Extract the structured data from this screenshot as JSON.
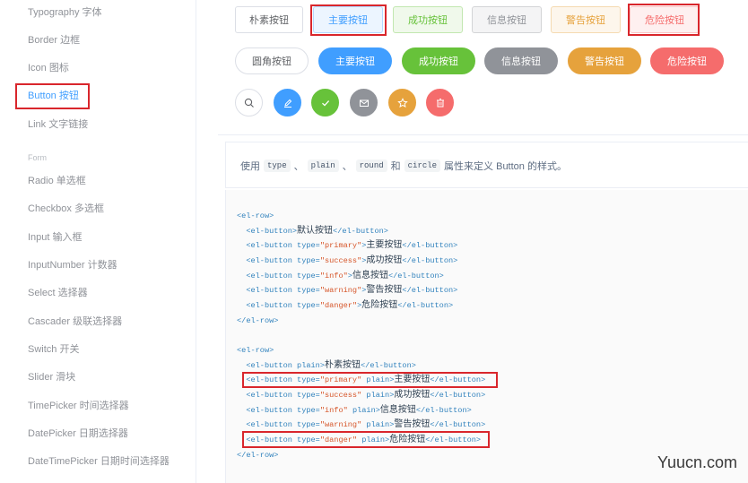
{
  "sidebar": {
    "items": [
      {
        "label": "Typography 字体"
      },
      {
        "label": "Border 边框"
      },
      {
        "label": "Icon 图标"
      },
      {
        "label": "Button 按钮"
      },
      {
        "label": "Link 文字链接"
      },
      {
        "label": "Form"
      },
      {
        "label": "Radio 单选框"
      },
      {
        "label": "Checkbox 多选框"
      },
      {
        "label": "Input 输入框"
      },
      {
        "label": "InputNumber 计数器"
      },
      {
        "label": "Select 选择器"
      },
      {
        "label": "Cascader 级联选择器"
      },
      {
        "label": "Switch 开关"
      },
      {
        "label": "Slider 滑块"
      },
      {
        "label": "TimePicker 时间选择器"
      },
      {
        "label": "DatePicker 日期选择器"
      },
      {
        "label": "DateTimePicker 日期时间选择器"
      }
    ]
  },
  "demo": {
    "plain_row": [
      "朴素按钮",
      "主要按钮",
      "成功按钮",
      "信息按钮",
      "警告按钮",
      "危险按钮"
    ],
    "round_row": [
      "圆角按钮",
      "主要按钮",
      "成功按钮",
      "信息按钮",
      "警告按钮",
      "危险按钮"
    ],
    "circle_icons": [
      "search-icon",
      "edit-icon",
      "check-icon",
      "message-icon",
      "star-icon",
      "delete-icon"
    ]
  },
  "description": {
    "prefix": "使用",
    "codes": [
      "type",
      "plain",
      "round",
      "circle"
    ],
    "sep1": "、",
    "sep2": "、",
    "and": "和",
    "suffix": "属性来定义 Button 的样式。"
  },
  "code": {
    "block1": [
      {
        "pre": "<el-row>",
        "str": "",
        "post": "",
        "text": ""
      },
      {
        "pre": "  <el-button>",
        "str": "",
        "post": "</el-button>",
        "text": "默认按钮"
      },
      {
        "pre": "  <el-button type=",
        "str": "\"primary\"",
        "post": ">",
        "text": "主要按钮",
        "close": "</el-button>"
      },
      {
        "pre": "  <el-button type=",
        "str": "\"success\"",
        "post": ">",
        "text": "成功按钮",
        "close": "</el-button>"
      },
      {
        "pre": "  <el-button type=",
        "str": "\"info\"",
        "post": ">",
        "text": "信息按钮",
        "close": "</el-button>"
      },
      {
        "pre": "  <el-button type=",
        "str": "\"warning\"",
        "post": ">",
        "text": "警告按钮",
        "close": "</el-button>"
      },
      {
        "pre": "  <el-button type=",
        "str": "\"danger\"",
        "post": ">",
        "text": "危险按钮",
        "close": "</el-button>"
      },
      {
        "pre": "</el-row>",
        "str": "",
        "post": "",
        "text": ""
      }
    ],
    "block2": [
      {
        "pre": "<el-row>",
        "str": "",
        "post": "",
        "text": ""
      },
      {
        "pre": "  <el-button plain>",
        "str": "",
        "post": "",
        "text": "朴素按钮",
        "close": "</el-button>"
      },
      {
        "pre": "  <el-button type=",
        "str": "\"primary\"",
        "post": " plain>",
        "text": "主要按钮",
        "close": "</el-button>"
      },
      {
        "pre": "  <el-button type=",
        "str": "\"success\"",
        "post": " plain>",
        "text": "成功按钮",
        "close": "</el-button>"
      },
      {
        "pre": "  <el-button type=",
        "str": "\"info\"",
        "post": " plain>",
        "text": "信息按钮",
        "close": "</el-button>"
      },
      {
        "pre": "  <el-button type=",
        "str": "\"warning\"",
        "post": " plain>",
        "text": "警告按钮",
        "close": "</el-button>"
      },
      {
        "pre": "  <el-button type=",
        "str": "\"danger\"",
        "post": " plain>",
        "text": "危险按钮",
        "close": "</el-button>"
      },
      {
        "pre": "</el-row>",
        "str": "",
        "post": "",
        "text": ""
      }
    ]
  },
  "watermark": "Yuucn.com"
}
